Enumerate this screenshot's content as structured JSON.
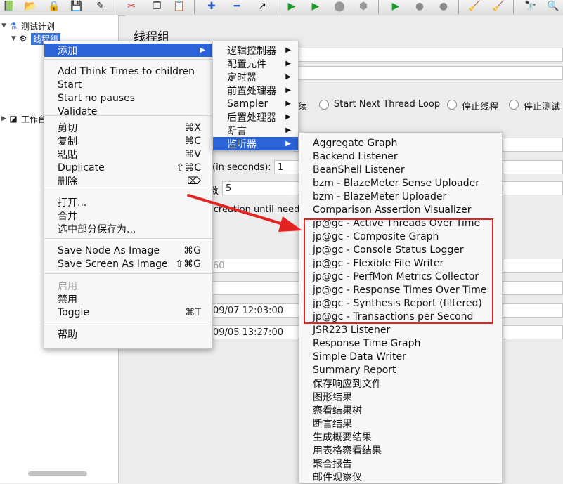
{
  "toolbar": {
    "icons": [
      "templates-icon",
      "open-icon",
      "lock-icon",
      "save-icon",
      "edit-icon",
      "cut-icon",
      "copy-icon",
      "paste-icon",
      "expand-icon",
      "collapse-icon",
      "toggle-icon",
      "start-icon",
      "start-no-pause-icon",
      "stop-icon",
      "shutdown-icon",
      "remote-start-icon",
      "remote-stop-icon",
      "remote-shutdown-icon",
      "clear-icon",
      "clear-all-icon",
      "search-icon",
      "reset-search-icon"
    ]
  },
  "tree": {
    "root_label": "测试计划",
    "thread_group_label": "线程组",
    "workbench_label": "工作台"
  },
  "panel": {
    "title": "线程组",
    "radio_labels": [
      "续",
      "Start Next Thread Loop",
      "停止线程",
      "停止测试"
    ],
    "rampup_label": "(in seconds):",
    "rampup_value": "1",
    "loop_label_tail": "数",
    "loop_value": "5",
    "delay_text": "l creation until need",
    "duration_hint": "60",
    "start_time": "09/07 12:03:00",
    "end_time": "09/05 13:27:00"
  },
  "context_menu": {
    "items": [
      {
        "label": "添加",
        "shortcut": "",
        "submenu": true,
        "highlight": true
      },
      {
        "label": "Add Think Times to children",
        "shortcut": ""
      },
      {
        "label": "Start",
        "shortcut": ""
      },
      {
        "label": "Start no pauses",
        "shortcut": ""
      },
      {
        "label": "Validate",
        "shortcut": ""
      },
      {
        "label": "剪切",
        "shortcut": "⌘X"
      },
      {
        "label": "复制",
        "shortcut": "⌘C"
      },
      {
        "label": "粘贴",
        "shortcut": "⌘V"
      },
      {
        "label": "Duplicate",
        "shortcut": "⇧⌘C"
      },
      {
        "label": "删除",
        "shortcut": "⌦"
      },
      {
        "label": "打开...",
        "shortcut": ""
      },
      {
        "label": "合并",
        "shortcut": ""
      },
      {
        "label": "选中部分保存为...",
        "shortcut": ""
      },
      {
        "label": "Save Node As Image",
        "shortcut": "⌘G"
      },
      {
        "label": "Save Screen As Image",
        "shortcut": "⇧⌘G"
      },
      {
        "label": "启用",
        "shortcut": "",
        "disabled": true
      },
      {
        "label": "禁用",
        "shortcut": ""
      },
      {
        "label": "Toggle",
        "shortcut": "⌘T"
      },
      {
        "label": "帮助",
        "shortcut": ""
      }
    ]
  },
  "add_submenu": {
    "items": [
      "逻辑控制器",
      "配置元件",
      "定时器",
      "前置处理器",
      "Sampler",
      "后置处理器",
      "断言",
      "监听器"
    ],
    "highlight_index": 7
  },
  "listener_submenu": {
    "items": [
      "Aggregate Graph",
      "Backend Listener",
      "BeanShell Listener",
      "bzm - BlazeMeter Sense Uploader",
      "bzm - BlazeMeter Uploader",
      "Comparison Assertion Visualizer",
      "jp@gc - Active Threads Over Time",
      "jp@gc - Composite Graph",
      "jp@gc - Console Status Logger",
      "jp@gc - Flexible File Writer",
      "jp@gc - PerfMon Metrics Collector",
      "jp@gc - Response Times Over Time",
      "jp@gc - Synthesis Report (filtered)",
      "jp@gc - Transactions per Second",
      "JSR223 Listener",
      "Response Time Graph",
      "Simple Data Writer",
      "Summary Report",
      "保存响应到文件",
      "图形结果",
      "察看结果树",
      "断言结果",
      "生成概要结果",
      "用表格察看结果",
      "聚合报告",
      "邮件观察仪"
    ]
  },
  "colors": {
    "highlight": "#2b63d8",
    "annotation_red": "#e32222"
  }
}
